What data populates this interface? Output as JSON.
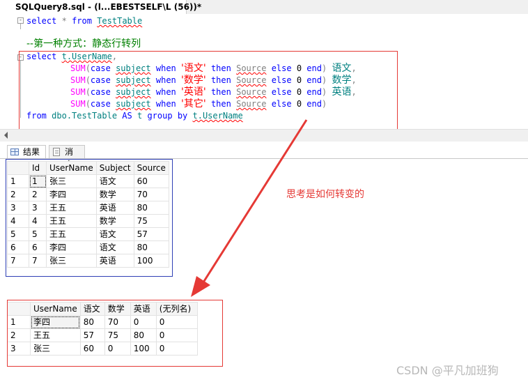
{
  "window": {
    "tab_title": "SQLQuery8.sql - (l...EBESTSELF\\L (56))*"
  },
  "editor": {
    "line1": {
      "select": "select",
      "star": "*",
      "from": "from",
      "table": "TestTable"
    },
    "comment": "--第一种方式：静态行转列",
    "line3": {
      "select": "select",
      "field": "t.UserName",
      "comma": ","
    },
    "case_lines": [
      {
        "sum": "SUM",
        "case": "case",
        "subject": "subject",
        "when": "when",
        "value": "'语文'",
        "then": "then",
        "source": "Source",
        "else": "else",
        "zero": "0",
        "end": "end",
        "alias": "语文",
        "trail": ","
      },
      {
        "sum": "SUM",
        "case": "case",
        "subject": "subject",
        "when": "when",
        "value": "'数学'",
        "then": "then",
        "source": "Source",
        "else": "else",
        "zero": "0",
        "end": "end",
        "alias": "数学",
        "trail": ","
      },
      {
        "sum": "SUM",
        "case": "case",
        "subject": "subject",
        "when": "when",
        "value": "'英语'",
        "then": "then",
        "source": "Source",
        "else": "else",
        "zero": "0",
        "end": "end",
        "alias": "英语",
        "trail": ","
      },
      {
        "sum": "SUM",
        "case": "case",
        "subject": "subject",
        "when": "when",
        "value": "'其它'",
        "then": "then",
        "source": "Source",
        "else": "else",
        "zero": "0",
        "end": "end",
        "alias": "",
        "trail": ""
      }
    ],
    "last_line": {
      "from": "from",
      "table": "dbo.TestTable",
      "as": "AS",
      "alias": "t",
      "group": "group",
      "by": "by",
      "field": "t.UserName"
    }
  },
  "results_tabs": {
    "results": "结果",
    "messages": "消息"
  },
  "table1": {
    "columns": [
      "Id",
      "UserName",
      "Subject",
      "Source"
    ],
    "rows": [
      [
        "1",
        "1",
        "张三",
        "语文",
        "60"
      ],
      [
        "2",
        "2",
        "李四",
        "数学",
        "70"
      ],
      [
        "3",
        "3",
        "王五",
        "英语",
        "80"
      ],
      [
        "4",
        "4",
        "王五",
        "数学",
        "75"
      ],
      [
        "5",
        "5",
        "王五",
        "语文",
        "57"
      ],
      [
        "6",
        "6",
        "李四",
        "语文",
        "80"
      ],
      [
        "7",
        "7",
        "张三",
        "英语",
        "100"
      ]
    ]
  },
  "table2": {
    "columns": [
      "UserName",
      "语文",
      "数学",
      "英语",
      "(无列名)"
    ],
    "rows": [
      [
        "1",
        "李四",
        "80",
        "70",
        "0",
        "0"
      ],
      [
        "2",
        "王五",
        "57",
        "75",
        "80",
        "0"
      ],
      [
        "3",
        "张三",
        "60",
        "0",
        "100",
        "0"
      ]
    ]
  },
  "annotation": "思考是如何转变的",
  "watermark": "CSDN @平凡加班狗",
  "colors": {
    "highlight": "#e53935",
    "blue_box": "#2e3fb5",
    "keyword": "#0000ff",
    "function": "#ff00ff",
    "string": "#ff0000",
    "comment": "#008000"
  }
}
